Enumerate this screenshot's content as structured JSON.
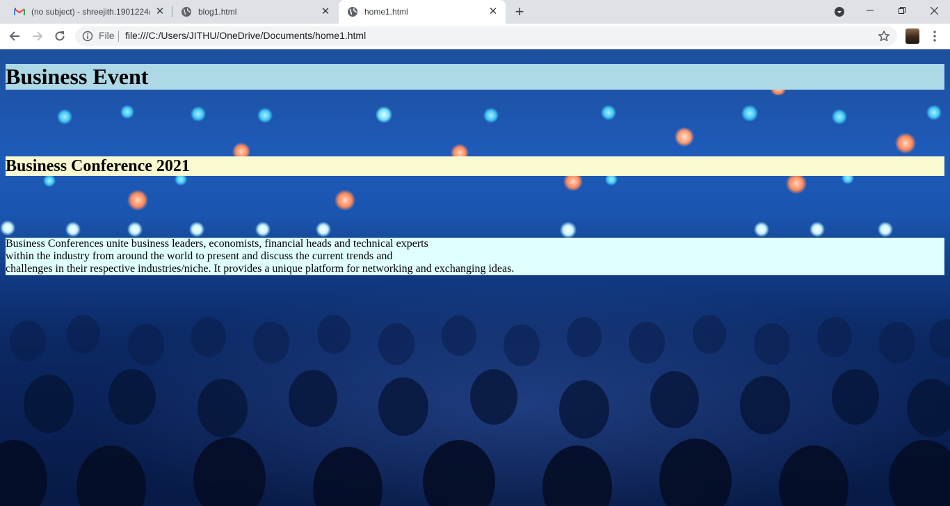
{
  "browser": {
    "tabs": [
      {
        "title": "(no subject) - shreejith.1901224@",
        "icon": "gmail-icon",
        "active": false
      },
      {
        "title": "blog1.html",
        "icon": "globe-icon",
        "active": false
      },
      {
        "title": "home1.html",
        "icon": "globe-icon",
        "active": true
      }
    ],
    "new_tab_label": "+",
    "address_bar": {
      "scheme_label": "File",
      "url": "file:///C:/Users/JITHU/OneDrive/Documents/home1.html"
    }
  },
  "page": {
    "heading": "Business Event",
    "subheading": "Business Conference 2021",
    "paragraph_lines": [
      "Business Conferences unite business leaders, economists, financial heads and technical experts",
      "within the industry from around the world to present and discuss the current trends and",
      "challenges in their respective industries/niche. It provides a unique platform for networking and exchanging ideas."
    ],
    "colors": {
      "heading_bg": "#add8e6",
      "subheading_bg": "#fafad2",
      "paragraph_bg": "#e0ffff"
    }
  }
}
